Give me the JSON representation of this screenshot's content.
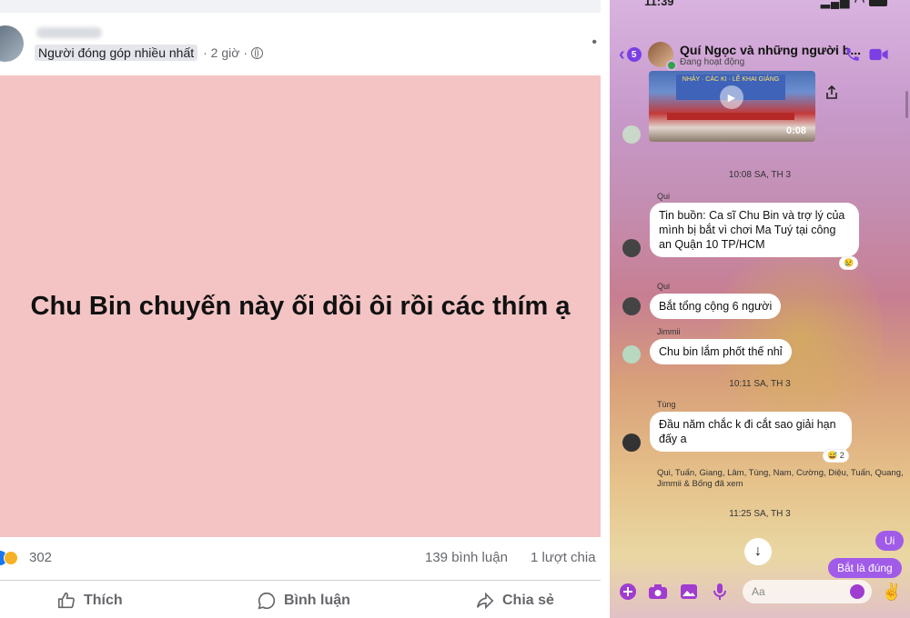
{
  "facebook_post": {
    "badge": "Người đóng góp nhiều nhất",
    "time": "· 2 giờ ·",
    "post_text": "Chu Bin chuyến này ối dồi ôi rồi các thím ạ",
    "reaction_count": "302",
    "comments": "139 bình luận",
    "shares": "1 lượt chia",
    "actions": {
      "like": "Thích",
      "comment": "Bình luận",
      "share": "Chia sẻ"
    },
    "colors": {
      "post_bg": "#f4c4c4",
      "like_blue": "#1877f2"
    }
  },
  "messenger": {
    "status_time": "11:39",
    "unread_count": "5",
    "group_name": "Quí Ngọc và những người b...",
    "group_status": "Đang hoạt động",
    "video_duration": "0:08",
    "video_banner": "NHẢY · CÁC KI · LỄ KHAI GIẢNG",
    "messages": [
      {
        "type": "timestamp",
        "text": "10:08 SA, TH 3"
      },
      {
        "sender": "Qui",
        "text": "Tin buồn: Ca sĩ Chu Bin và trợ lý của mình bị bắt vì chơi Ma Tuý tại công an Quận 10 TP/HCM",
        "reaction": "😢"
      },
      {
        "sender": "Qui",
        "text": "Bắt tổng cộng 6 người"
      },
      {
        "sender": "Jimmii",
        "text": "Chu bin lắm phốt thế nhỉ"
      },
      {
        "type": "timestamp",
        "text": "10:11 SA, TH 3"
      },
      {
        "sender": "Tùng",
        "text": "Đầu năm chắc k đi cắt sao giải hạn đấy a",
        "reaction": "😅 2"
      }
    ],
    "seen_by": "Qui, Tuấn, Giang, Lâm, Tùng, Nam, Cường, Diệu, Tuấn, Quang, Jimmii & Bống đã xem",
    "timestamp_last": "11:25 SA, TH 3",
    "outgoing": [
      "Ui",
      "Bắt là đúng"
    ],
    "input_placeholder": "Aa",
    "colors": {
      "accent": "#a03ccf",
      "outgoing_bubble": "#a05ce8"
    }
  }
}
